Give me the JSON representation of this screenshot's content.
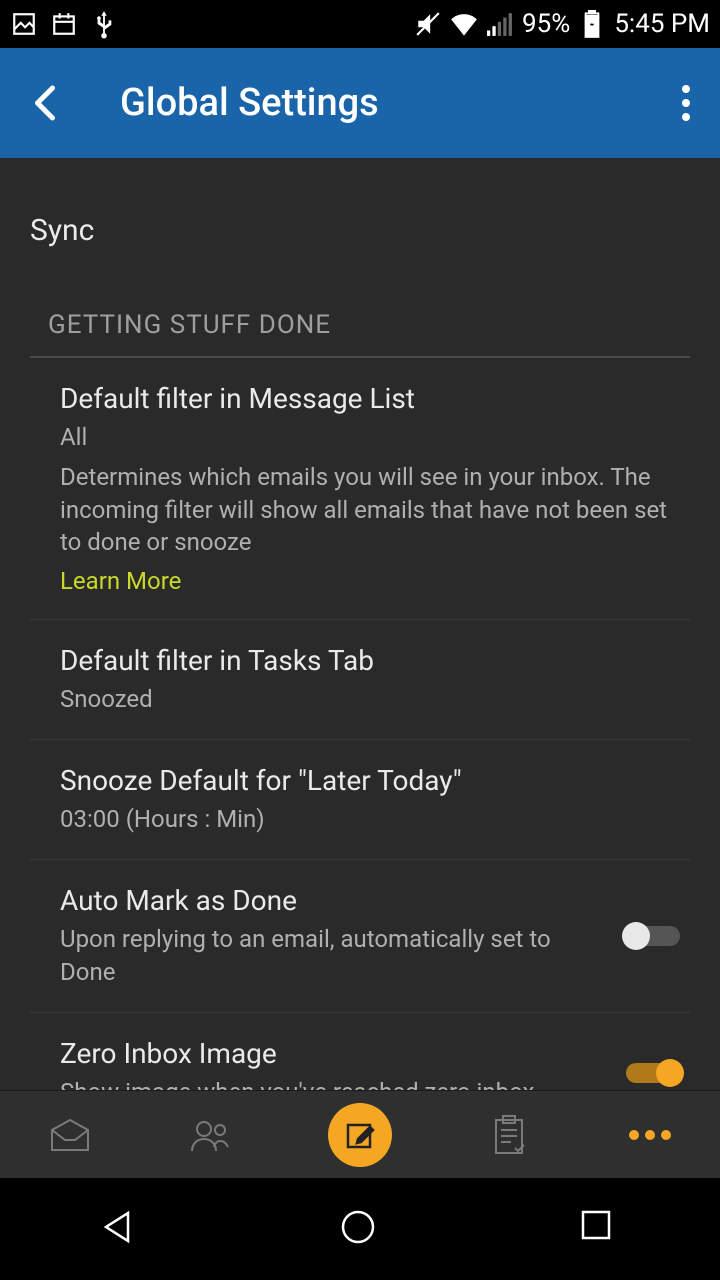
{
  "status": {
    "battery": "95%",
    "time": "5:45 PM"
  },
  "header": {
    "title": "Global Settings"
  },
  "sync": {
    "label": "Sync"
  },
  "section": {
    "header": "GETTING STUFF DONE"
  },
  "settings": {
    "filter_msg": {
      "title": "Default filter in Message List",
      "value": "All",
      "desc": "Determines which emails you will see in your inbox. The incoming filter will show all emails that have not been set to done or snooze",
      "learn": "Learn More"
    },
    "filter_tasks": {
      "title": "Default filter in Tasks Tab",
      "value": "Snoozed"
    },
    "snooze": {
      "title": "Snooze Default for \"Later Today\"",
      "value": "03:00 (Hours : Min)"
    },
    "automark": {
      "title": "Auto Mark as Done",
      "desc": "Upon replying to an email, automatically set to Done",
      "on": false
    },
    "zeroinbox": {
      "title": "Zero Inbox Image",
      "desc": "Show image when you've reached zero inbox",
      "on": true
    }
  }
}
